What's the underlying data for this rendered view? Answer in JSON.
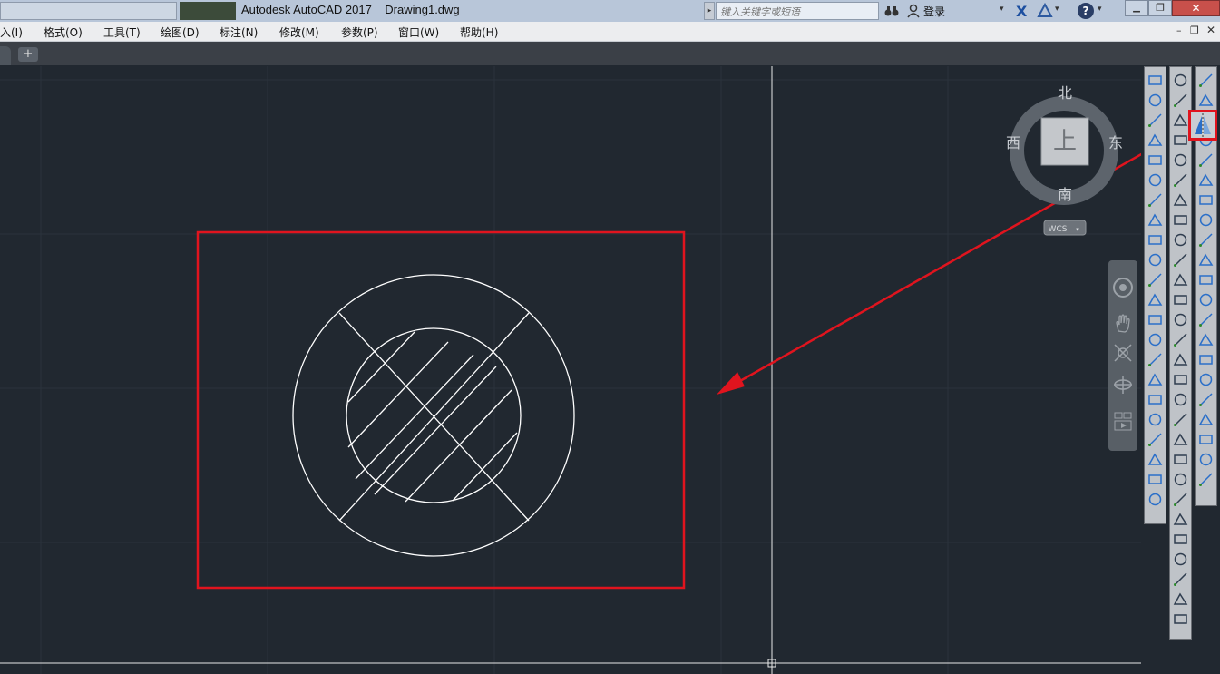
{
  "window": {
    "app_title": "Autodesk AutoCAD 2017",
    "document": "Drawing1.dwg",
    "search_placeholder": "键入关键字或短语",
    "login": "登录"
  },
  "menu": [
    {
      "id": "insert",
      "label": "入(I)"
    },
    {
      "id": "format",
      "label": "格式(O)"
    },
    {
      "id": "tools",
      "label": "工具(T)"
    },
    {
      "id": "draw",
      "label": "绘图(D)"
    },
    {
      "id": "dimension",
      "label": "标注(N)"
    },
    {
      "id": "modify",
      "label": "修改(M)"
    },
    {
      "id": "params",
      "label": "参数(P)"
    },
    {
      "id": "window",
      "label": "窗口(W)"
    },
    {
      "id": "help",
      "label": "帮助(H)"
    }
  ],
  "viewcube": {
    "north": "北",
    "south": "南",
    "east": "东",
    "west": "西",
    "face": "上",
    "wcs": "WCS"
  },
  "colors": {
    "canvas_bg": "#212830",
    "annotation_red": "#e0141e",
    "drawing_white": "#ffffff"
  },
  "icons": {
    "highlighted_tool": "mirror-icon",
    "new_tab": "plus-icon",
    "help": "help-icon",
    "user": "user-icon"
  }
}
